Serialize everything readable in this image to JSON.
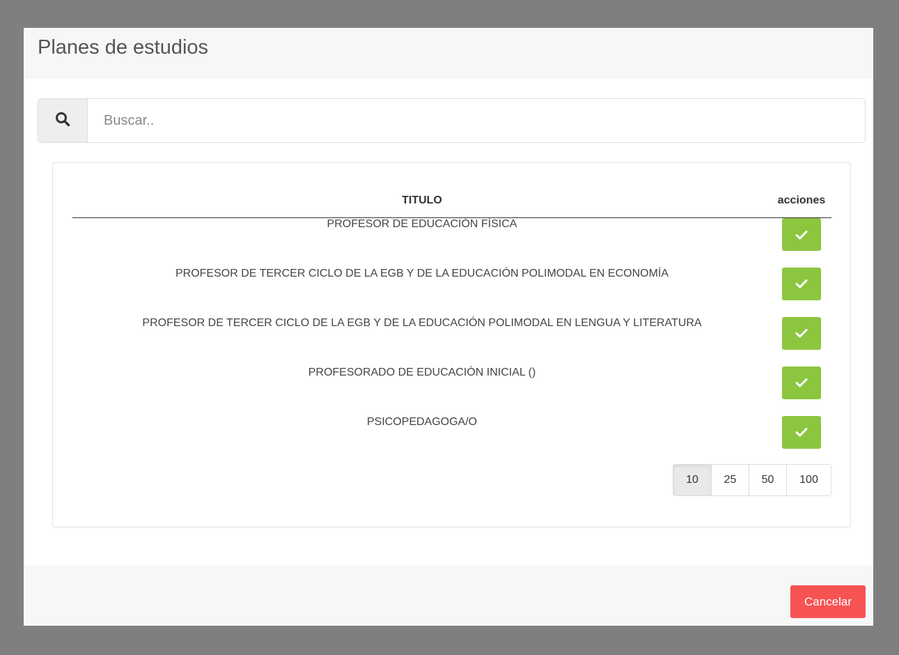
{
  "modal": {
    "title": "Planes de estudios"
  },
  "search": {
    "placeholder": "Buscar.."
  },
  "table": {
    "headers": {
      "title": "TITULO",
      "actions": "acciones"
    },
    "rows": [
      {
        "title": "PROFESOR DE EDUCACIÓN FÍSICA"
      },
      {
        "title": "PROFESOR DE TERCER CICLO DE LA EGB Y DE LA EDUCACIÓN POLIMODAL EN ECONOMÍA"
      },
      {
        "title": "PROFESOR DE TERCER CICLO DE LA EGB Y DE LA EDUCACIÓN POLIMODAL EN LENGUA Y LITERATURA"
      },
      {
        "title": "PROFESORADO DE EDUCACIÓN INICIAL ()"
      },
      {
        "title": "PSICOPEDAGOGA/O"
      }
    ]
  },
  "pagination": {
    "options": [
      "10",
      "25",
      "50",
      "100"
    ],
    "selected": "10"
  },
  "footer": {
    "cancel_label": "Cancelar"
  },
  "colors": {
    "select_button": "#8cc63f",
    "cancel_button": "#f75353",
    "backdrop": "#7f7f7f"
  },
  "icons": {
    "search": "search-icon",
    "select": "check-icon"
  }
}
